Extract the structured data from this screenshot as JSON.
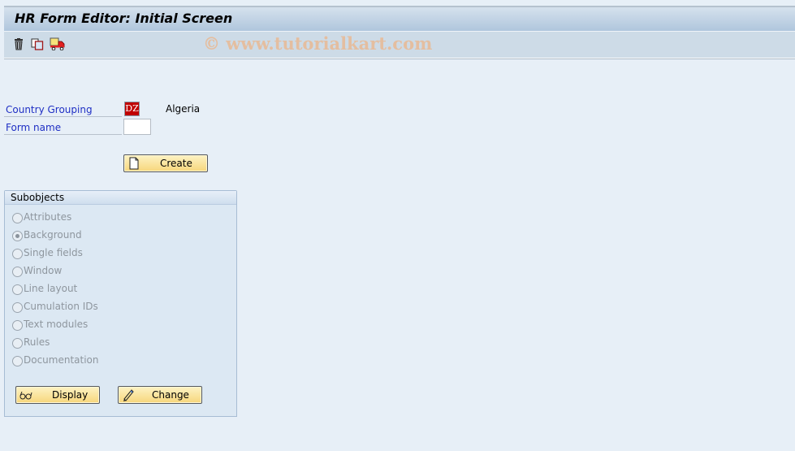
{
  "window": {
    "title": "HR Form Editor: Initial Screen"
  },
  "toolbar": {
    "icons": [
      "delete-icon",
      "copy-icon",
      "transport-icon"
    ],
    "watermark": "© www.tutorialkart.com"
  },
  "form": {
    "country_grouping": {
      "label": "Country Grouping",
      "value": "DZ",
      "description": "Algeria"
    },
    "form_name": {
      "label": "Form name",
      "value": ""
    },
    "create_label": "Create"
  },
  "subobjects": {
    "title": "Subobjects",
    "options": [
      {
        "label": "Attributes",
        "selected": false
      },
      {
        "label": "Background",
        "selected": true
      },
      {
        "label": "Single fields",
        "selected": false
      },
      {
        "label": "Window",
        "selected": false
      },
      {
        "label": "Line layout",
        "selected": false
      },
      {
        "label": "Cumulation IDs",
        "selected": false
      },
      {
        "label": "Text modules",
        "selected": false
      },
      {
        "label": "Rules",
        "selected": false
      },
      {
        "label": "Documentation",
        "selected": false
      }
    ],
    "display_label": "Display",
    "change_label": "Change"
  }
}
